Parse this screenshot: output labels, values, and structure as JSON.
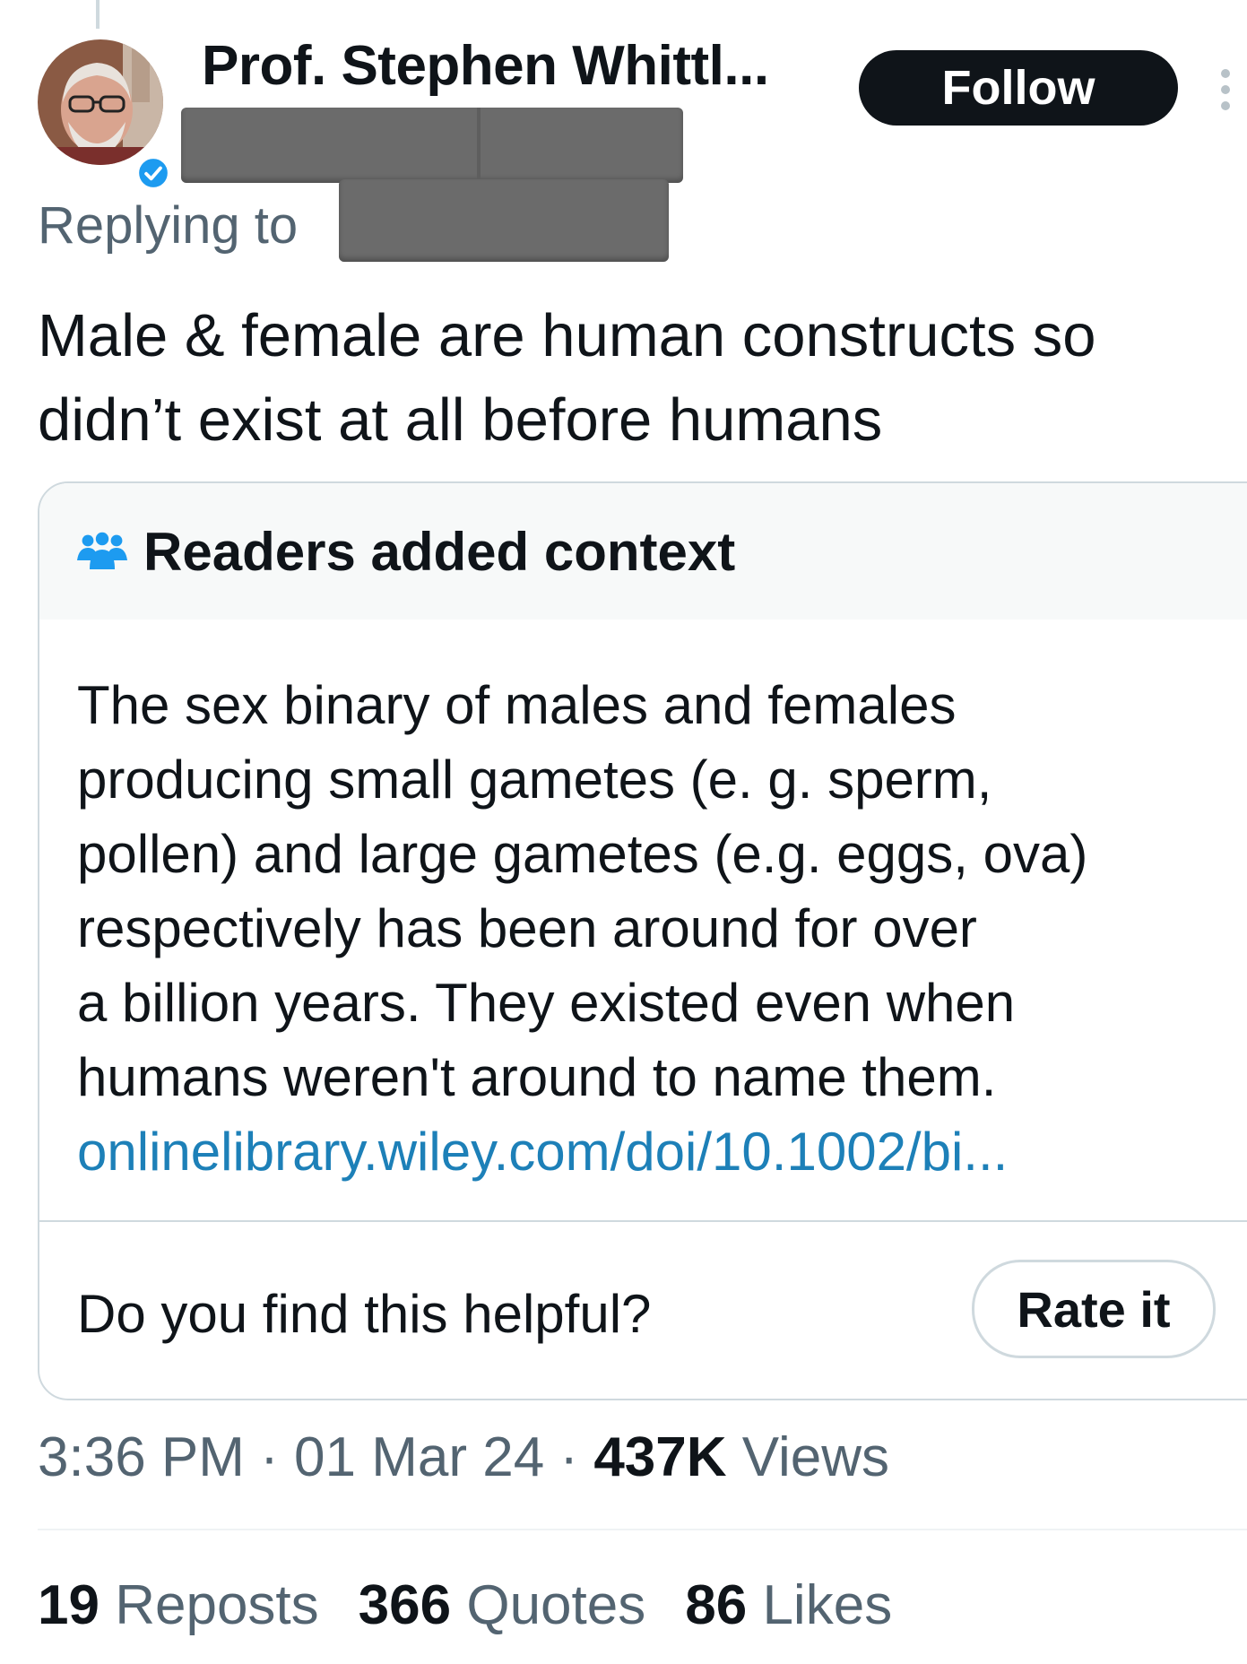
{
  "author": {
    "name": "Prof. Stephen Whittl...",
    "verified_badge_icon": "verified-checkmark-icon",
    "verified_color": "#1d9bf0"
  },
  "follow_button": {
    "label": "Follow"
  },
  "more_options_icon": "more-vertical-icon",
  "replying_to": {
    "label": "Replying to"
  },
  "tweet": {
    "text": "Male & female are human constructs so didn’t exist at all before humans"
  },
  "community_note": {
    "header_icon": "people-icon",
    "title": "Readers added context",
    "body_lines": [
      "The sex binary of males and females",
      "producing small gametes (e. g. sperm,",
      "pollen) and large gametes (e.g. eggs, ova)",
      "respectively has been around for over",
      "a billion years. They existed even when",
      "humans weren't around to name them."
    ],
    "link": "onlinelibrary.wiley.com/doi/10.1002/bi...",
    "link_color": "#1d80b8",
    "helpful_prompt": "Do you find this helpful?",
    "rate_button": "Rate it"
  },
  "meta": {
    "time": "3:36 PM",
    "separator": "·",
    "date": "01 Mar 24",
    "views_count": "437K",
    "views_label": "Views"
  },
  "stats": [
    {
      "count": "19",
      "label": "Reposts"
    },
    {
      "count": "366",
      "label": "Quotes"
    },
    {
      "count": "86",
      "label": "Likes"
    }
  ]
}
